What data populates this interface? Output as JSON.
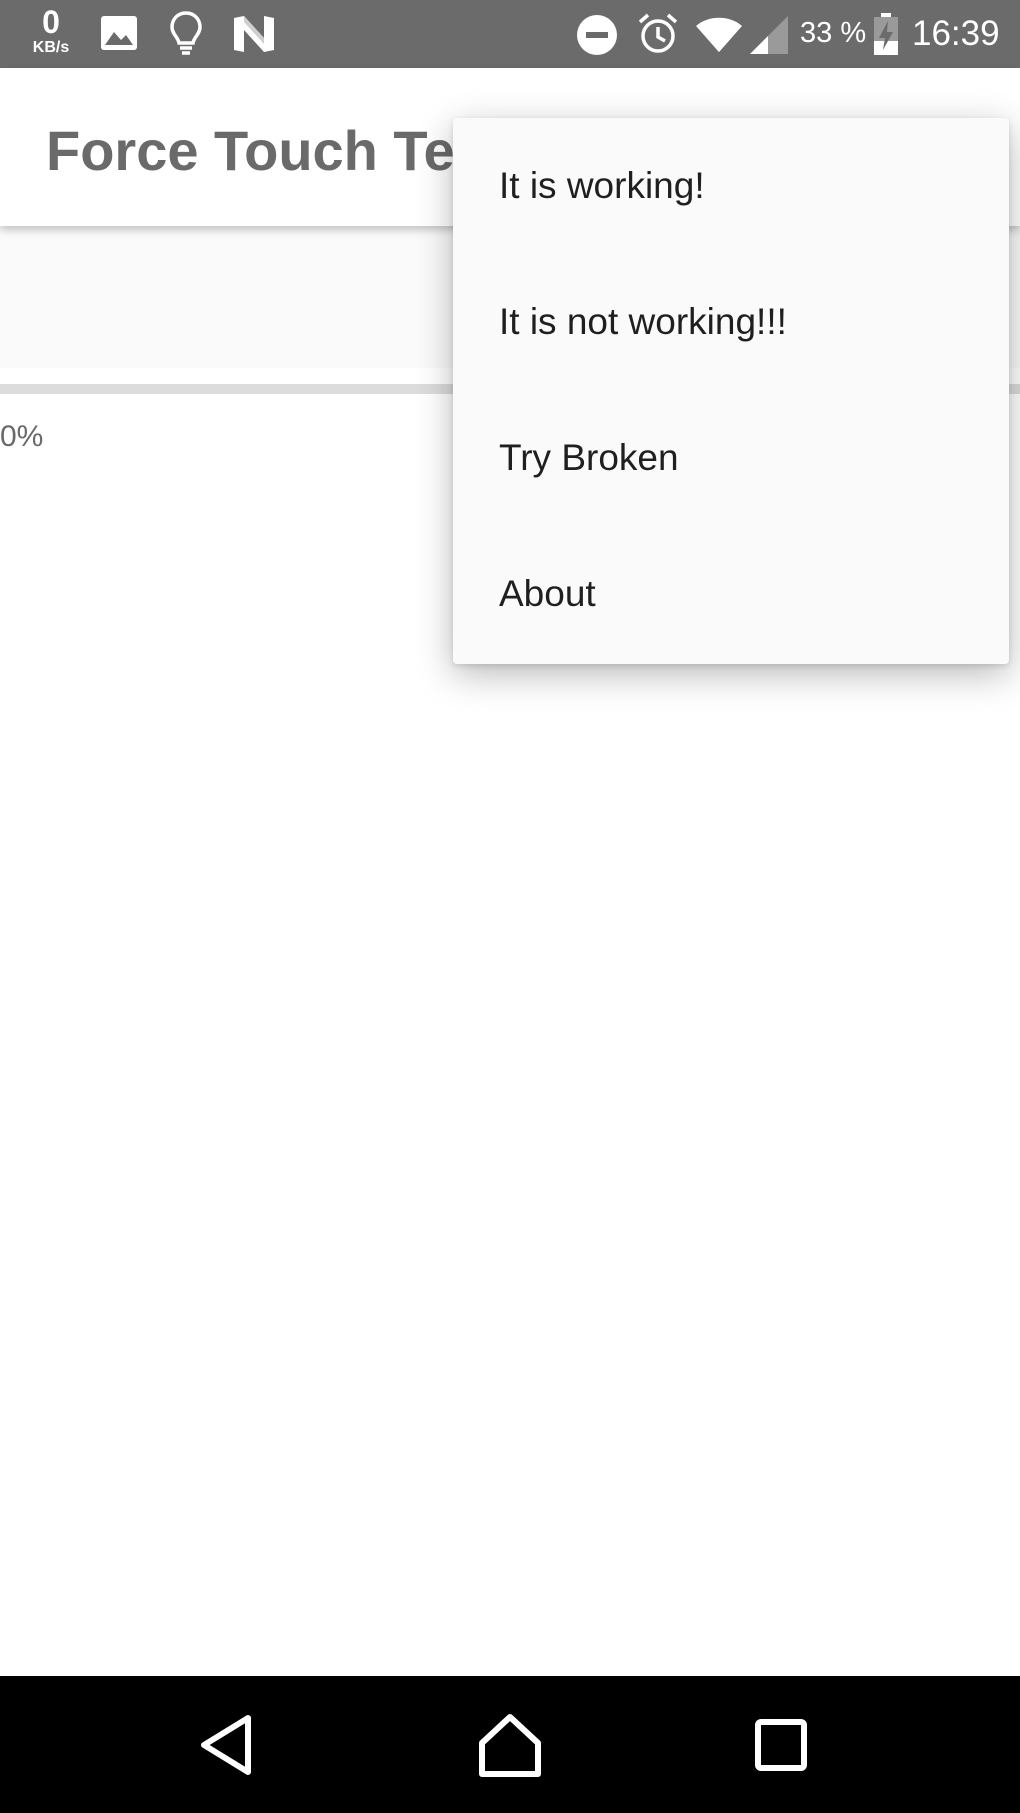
{
  "status_bar": {
    "net_speed_value": "0",
    "net_speed_unit": "KB/s",
    "battery_percent": "33 %",
    "time": "16:39",
    "icons": [
      "image-icon",
      "lightbulb-icon",
      "n-logo-icon",
      "do-not-disturb-icon",
      "alarm-icon",
      "wifi-icon",
      "signal-icon",
      "battery-charging-icon"
    ]
  },
  "app_bar": {
    "title": "Force Touch Tes"
  },
  "content": {
    "progress_value_percent": 0,
    "progress_label": "0%"
  },
  "menu": {
    "items": [
      {
        "label": "It is working!"
      },
      {
        "label": "It is not working!!!"
      },
      {
        "label": "Try Broken"
      },
      {
        "label": "About"
      }
    ]
  },
  "nav_bar": {
    "icons": [
      "back-icon",
      "home-icon",
      "recents-icon"
    ]
  },
  "colors": {
    "status_bar_bg": "#6b6b6b",
    "title_text": "#6a6a6a",
    "menu_bg": "#fafafa",
    "progress_track": "#dcdcdc",
    "nav_bar_bg": "#000000"
  }
}
